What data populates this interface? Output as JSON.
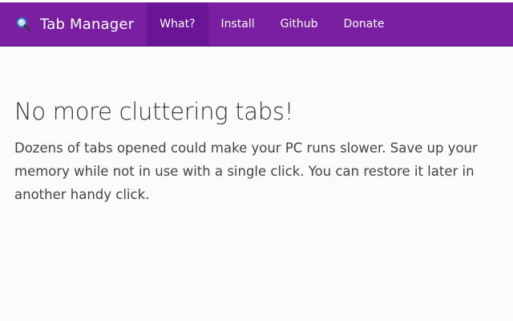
{
  "navbar": {
    "brand": {
      "icon": "magnifier-icon",
      "label": "Tab Manager"
    },
    "links": [
      {
        "label": "What?",
        "active": true
      },
      {
        "label": "Install",
        "active": false
      },
      {
        "label": "Github",
        "active": false
      },
      {
        "label": "Donate",
        "active": false
      }
    ],
    "colors": {
      "background": "#7a1fa2",
      "active_background": "#6a1595",
      "text": "#ffffff"
    }
  },
  "main": {
    "headline": "No more cluttering tabs!",
    "description": "Dozens of tabs opened could make your PC runs slower. Save up your memory while not in use with a single click. You can restore it later in another handy click."
  }
}
